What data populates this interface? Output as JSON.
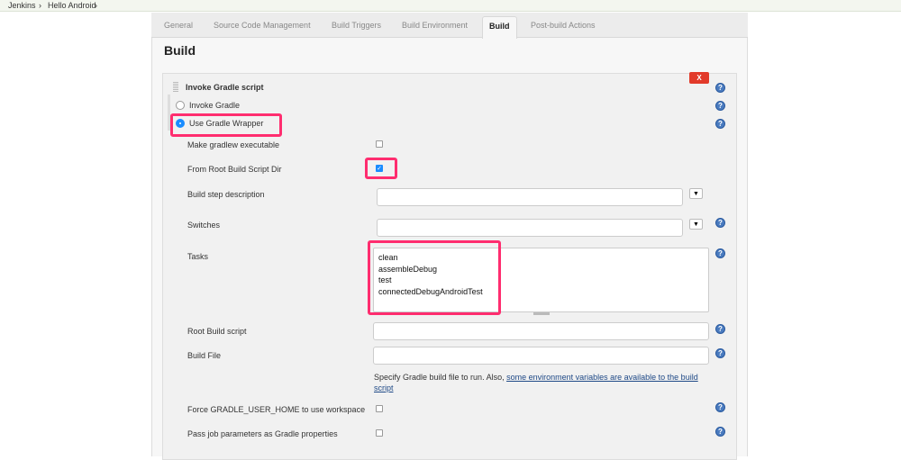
{
  "breadcrumbs": [
    "Jenkins",
    "Hello Android"
  ],
  "tabs": [
    "General",
    "Source Code Management",
    "Build Triggers",
    "Build Environment",
    "Build",
    "Post-build Actions"
  ],
  "active_tab": "Build",
  "section_title": "Build",
  "step": {
    "title": "Invoke Gradle script",
    "delete_label": "X",
    "radio_invoke": "Invoke Gradle",
    "radio_wrapper": "Use Gradle Wrapper",
    "selected": "Use Gradle Wrapper",
    "make_executable": {
      "label": "Make gradlew executable",
      "checked": false
    },
    "from_root": {
      "label": "From Root Build Script Dir",
      "checked": true
    },
    "build_step_description": {
      "label": "Build step description",
      "value": ""
    },
    "switches": {
      "label": "Switches",
      "value": ""
    },
    "tasks": {
      "label": "Tasks",
      "lines": [
        "clean",
        "assembleDebug",
        "test",
        "connectedDebugAndroidTest"
      ]
    },
    "root_build_script": {
      "label": "Root Build script",
      "value": ""
    },
    "build_file": {
      "label": "Build File",
      "value": "",
      "help_text": "Specify Gradle build file to run. Also, ",
      "help_link": "some environment variables are available to the build script"
    },
    "force_home": {
      "label": "Force GRADLE_USER_HOME to use workspace",
      "checked": false
    },
    "pass_params": {
      "label": "Pass job parameters as Gradle properties",
      "checked": false
    }
  },
  "colors": {
    "highlight": "#ff2d6f",
    "delete": "#e23a2a",
    "radio": "#1a8cff"
  }
}
